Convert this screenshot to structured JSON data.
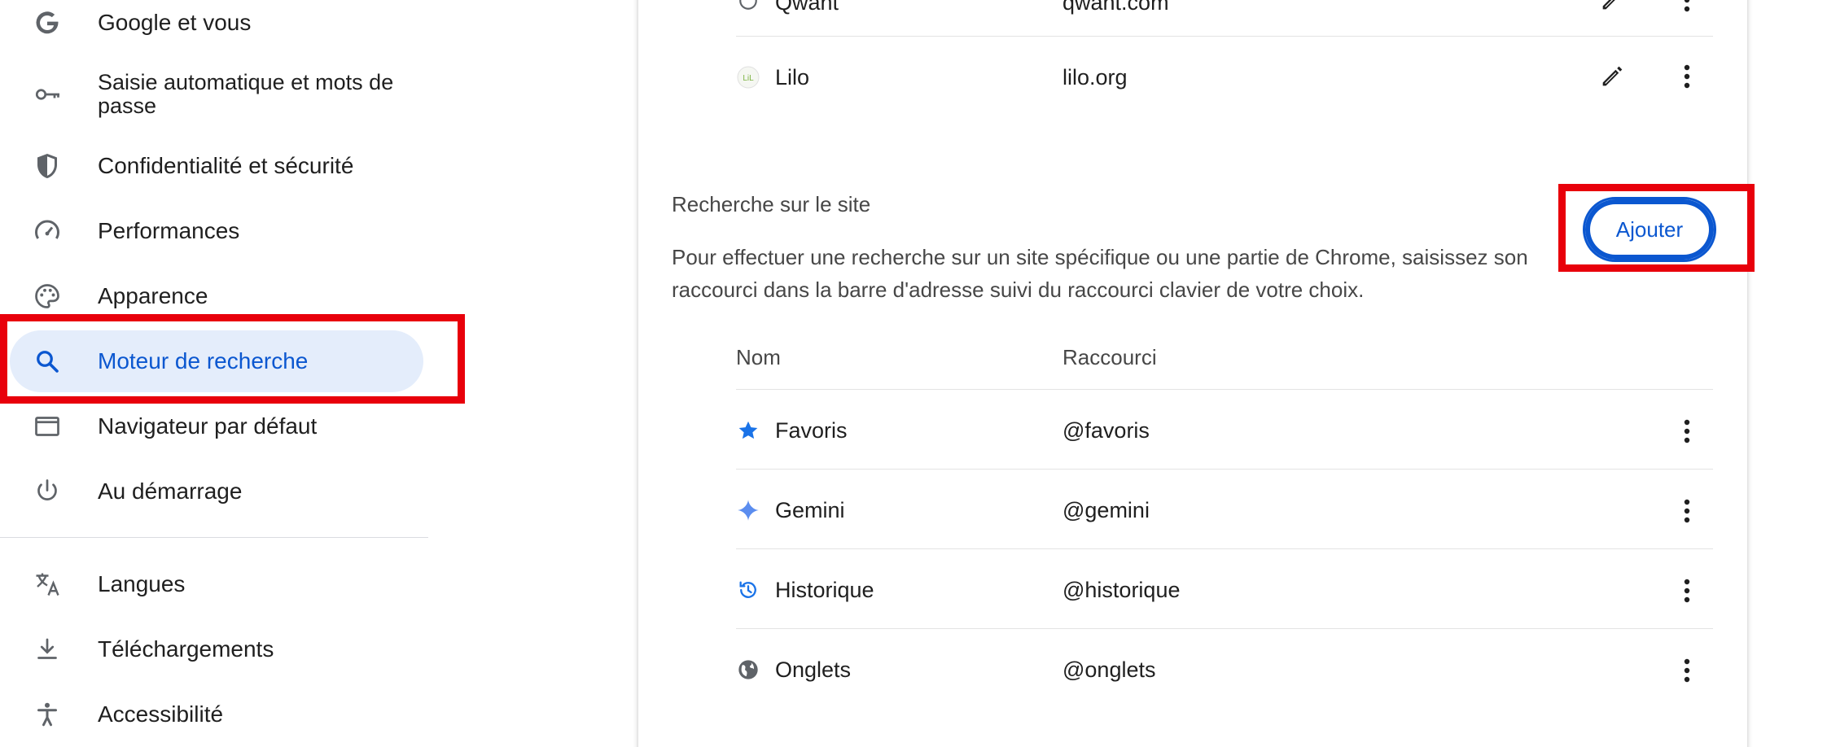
{
  "sidebar": {
    "items": [
      {
        "label": "Google et vous",
        "icon": "google-g-icon"
      },
      {
        "label": "Saisie automatique et mots de passe",
        "icon": "key-icon"
      },
      {
        "label": "Confidentialité et sécurité",
        "icon": "shield-icon"
      },
      {
        "label": "Performances",
        "icon": "speedometer-icon"
      },
      {
        "label": "Apparence",
        "icon": "palette-icon"
      },
      {
        "label": "Moteur de recherche",
        "icon": "search-icon",
        "active": true
      },
      {
        "label": "Navigateur par défaut",
        "icon": "browser-window-icon"
      },
      {
        "label": "Au démarrage",
        "icon": "power-icon"
      },
      {
        "label": "Langues",
        "icon": "translate-icon"
      },
      {
        "label": "Téléchargements",
        "icon": "download-icon"
      },
      {
        "label": "Accessibilité",
        "icon": "accessibility-icon"
      }
    ]
  },
  "engines": {
    "rows": [
      {
        "name": "Qwant",
        "shortcut": "qwant.com",
        "icon": "qwant-icon"
      },
      {
        "name": "Lilo",
        "shortcut": "lilo.org",
        "icon": "lilo-icon"
      }
    ]
  },
  "site_search": {
    "title": "Recherche sur le site",
    "description": "Pour effectuer une recherche sur un site spécifique ou une partie de Chrome, saisissez son raccourci dans la barre d'adresse suivi du raccourci clavier de votre choix.",
    "add_label": "Ajouter",
    "columns": {
      "name": "Nom",
      "shortcut": "Raccourci"
    },
    "rows": [
      {
        "name": "Favoris",
        "shortcut": "@favoris",
        "icon": "star-icon"
      },
      {
        "name": "Gemini",
        "shortcut": "@gemini",
        "icon": "gemini-sparkle-icon"
      },
      {
        "name": "Historique",
        "shortcut": "@historique",
        "icon": "history-icon"
      },
      {
        "name": "Onglets",
        "shortcut": "@onglets",
        "icon": "globe-icon"
      }
    ]
  },
  "colors": {
    "accent": "#0b57d0",
    "active_bg": "#e4edfb",
    "annotation": "#e8000b"
  }
}
